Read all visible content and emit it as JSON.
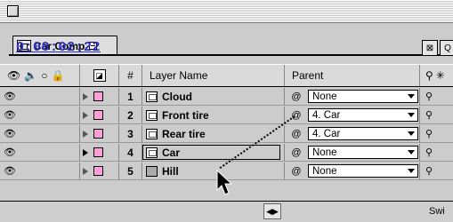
{
  "window": {
    "title": ""
  },
  "comp": {
    "tab_label": "Car Comp",
    "timecode": "0:00:02:22"
  },
  "header": {
    "layer_number": "#",
    "layer_name": "Layer Name",
    "parent": "Parent"
  },
  "layers": [
    {
      "number": "1",
      "name": "Cloud",
      "parent": "None",
      "icon": "footage-icon",
      "selected": false
    },
    {
      "number": "2",
      "name": "Front tire",
      "parent": "4. Car",
      "icon": "footage-icon",
      "selected": false
    },
    {
      "number": "3",
      "name": "Rear tire",
      "parent": "4. Car",
      "icon": "footage-icon",
      "selected": false
    },
    {
      "number": "4",
      "name": "Car",
      "parent": "None",
      "icon": "footage-icon",
      "selected": true
    },
    {
      "number": "5",
      "name": "Hill",
      "parent": "None",
      "icon": "solid-icon",
      "selected": false
    }
  ],
  "footer": {
    "switches_label": "Swi"
  },
  "colors": {
    "label_swatch": "#ff9edb",
    "timecode": "#2d2dc8"
  }
}
